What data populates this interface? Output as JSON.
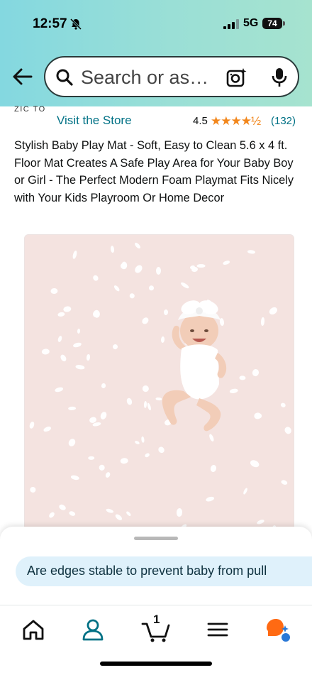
{
  "status_bar": {
    "time": "12:57",
    "network": "5G",
    "battery": "74"
  },
  "search": {
    "placeholder": "Search or as…"
  },
  "store": {
    "logo_text": "ZIC  TO",
    "visit_label": "Visit the Store",
    "rating": "4.5",
    "stars": "★★★★½",
    "rating_count": "(132)"
  },
  "product": {
    "title": "Stylish Baby Play Mat - Soft, Easy to Clean 5.6 x 4 ft. Floor Mat Creates A Safe Play Area for Your Baby Boy or Girl - The Perfect Modern Foam Playmat Fits Nicely with Your Kids Playroom Or Home Decor"
  },
  "ask": {
    "question": "Are edges stable to prevent baby from pull"
  },
  "nav": {
    "cart_count": "1",
    "items": [
      "home-icon",
      "account-icon",
      "cart-icon",
      "menu-icon",
      "rufus-icon"
    ]
  },
  "colors": {
    "link": "#007185",
    "star": "#f2861b",
    "chip": "#dff1fb",
    "mat": "#f4e3e0"
  }
}
